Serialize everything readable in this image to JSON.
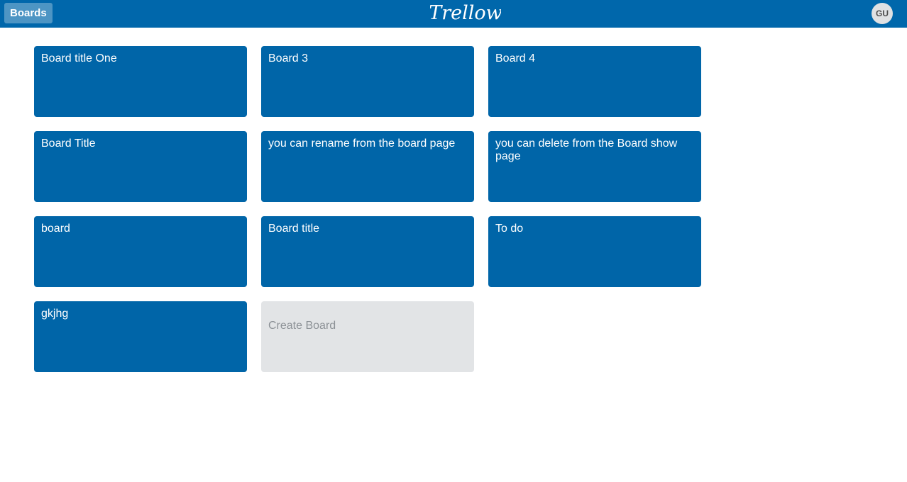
{
  "header": {
    "boards_label": "Boards",
    "logo_text": "Trellow",
    "avatar_initials": "GU",
    "bar_color": "#0067ab"
  },
  "boards": [
    {
      "title": "Board title One"
    },
    {
      "title": "Board 3"
    },
    {
      "title": "Board 4"
    },
    {
      "title": "Board Title"
    },
    {
      "title": "you can rename from the board page"
    },
    {
      "title": "you can delete from the Board show page"
    },
    {
      "title": "board"
    },
    {
      "title": "Board title"
    },
    {
      "title": "To do"
    },
    {
      "title": "gkjhg"
    }
  ],
  "create_board_label": "Create Board",
  "colors": {
    "tile": "#0065a8",
    "create_tile": "#e2e4e6",
    "create_text": "#8c9196"
  }
}
